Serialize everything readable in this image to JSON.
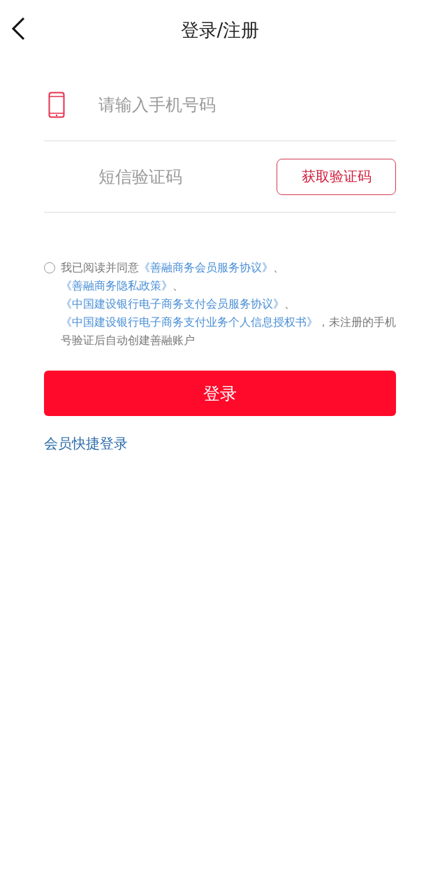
{
  "header": {
    "title": "登录/注册"
  },
  "phone_field": {
    "placeholder": "请输入手机号码"
  },
  "code_field": {
    "placeholder": "短信验证码"
  },
  "get_code_button": {
    "label": "获取验证码"
  },
  "agreement": {
    "checked": false,
    "parts": [
      {
        "kind": "text",
        "text": "我已阅读并同意"
      },
      {
        "kind": "link",
        "text": "《善融商务会员服务协议》"
      },
      {
        "kind": "text",
        "text": "、"
      },
      {
        "kind": "link",
        "text": "《善融商务隐私政策》"
      },
      {
        "kind": "text",
        "text": "、"
      },
      {
        "kind": "link",
        "text": "《中国建设银行电子商务支付会员服务协议》"
      },
      {
        "kind": "text",
        "text": "、"
      },
      {
        "kind": "link",
        "text": "《中国建设银行电子商务支付业务个人信息授权书》"
      },
      {
        "kind": "text",
        "text": "，未注册的手机号验证后自动创建善融账户"
      }
    ]
  },
  "login_button": {
    "label": "登录"
  },
  "quick_login_link": {
    "label": "会员快捷登录"
  }
}
